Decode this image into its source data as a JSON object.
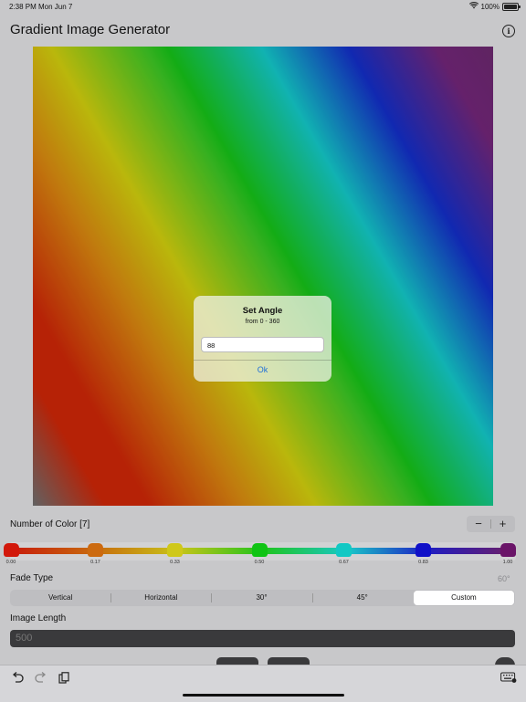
{
  "status": {
    "time": "2:38 PM",
    "date": "Mon Jun 7",
    "battery": "100%"
  },
  "app": {
    "title": "Gradient Image Generator"
  },
  "alert": {
    "title": "Set Angle",
    "message": "from 0 - 360",
    "value": "88",
    "ok_label": "Ok"
  },
  "colors": {
    "count_label": "Number of Color [7]",
    "minus": "−",
    "plus": "+",
    "stops": [
      {
        "pos": "0.00",
        "color": "#d2180a"
      },
      {
        "pos": "0.17",
        "color": "#cc6a10"
      },
      {
        "pos": "0.33",
        "color": "#cfc81a"
      },
      {
        "pos": "0.50",
        "color": "#10c414"
      },
      {
        "pos": "0.67",
        "color": "#12c8c4"
      },
      {
        "pos": "0.83",
        "color": "#1010c8"
      },
      {
        "pos": "1.00",
        "color": "#6a1468"
      }
    ]
  },
  "fade": {
    "label": "Fade Type",
    "value": "60°",
    "options": [
      "Vertical",
      "Horizontal",
      "30°",
      "45°",
      "Custom"
    ],
    "selected": "Custom"
  },
  "length": {
    "label": "Image Length",
    "placeholder": "500"
  },
  "icons": {
    "info": "info-icon",
    "undo": "undo-icon",
    "redo": "redo-icon",
    "paste": "clipboard-icon",
    "keyboard": "keyboard-icon"
  }
}
